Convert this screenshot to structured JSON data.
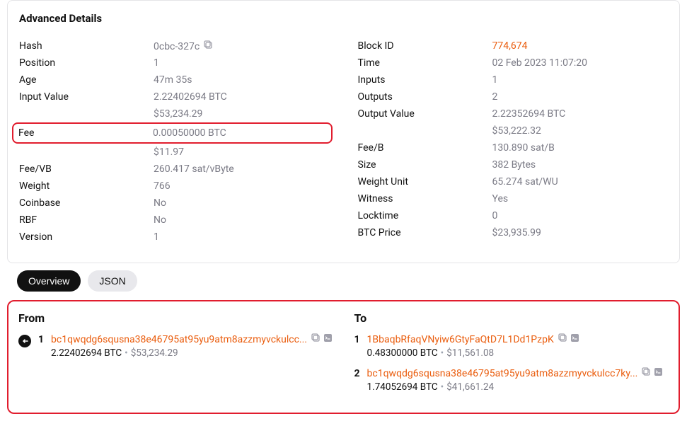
{
  "title": "Advanced Details",
  "left": [
    {
      "label": "Hash",
      "value": "0cbc-327c",
      "copy": true
    },
    {
      "label": "Position",
      "value": "1"
    },
    {
      "label": "Age",
      "value": "47m 35s"
    },
    {
      "label": "Input Value",
      "value": "2.22402694 BTC",
      "sub": "$53,234.29"
    },
    {
      "label": "Fee",
      "value": "0.00050000 BTC",
      "sub": "$11.97",
      "highlight": true
    },
    {
      "label": "Fee/VB",
      "value": "260.417 sat/vByte"
    },
    {
      "label": "Weight",
      "value": "766"
    },
    {
      "label": "Coinbase",
      "value": "No"
    },
    {
      "label": "RBF",
      "value": "No"
    },
    {
      "label": "Version",
      "value": "1"
    }
  ],
  "right": [
    {
      "label": "Block ID",
      "value": "774,674",
      "link": true
    },
    {
      "label": "Time",
      "value": "02 Feb 2023 11:07:20"
    },
    {
      "label": "Inputs",
      "value": "1"
    },
    {
      "label": "Outputs",
      "value": "2"
    },
    {
      "label": "Output Value",
      "value": "2.22352694 BTC",
      "sub": "$53,222.32"
    },
    {
      "label": "Fee/B",
      "value": "130.890 sat/B"
    },
    {
      "label": "Size",
      "value": "382 Bytes"
    },
    {
      "label": "Weight Unit",
      "value": "65.274 sat/WU"
    },
    {
      "label": "Witness",
      "value": "Yes"
    },
    {
      "label": "Locktime",
      "value": "0"
    },
    {
      "label": "BTC Price",
      "value": "$23,935.99"
    }
  ],
  "tabs": {
    "overview": "Overview",
    "json": "JSON"
  },
  "from_label": "From",
  "to_label": "To",
  "inputs": [
    {
      "idx": "1",
      "addr": "bc1qwqdg6squsna38e46795at95yu9atm8azzmyvckulcc...",
      "btc": "2.22402694 BTC",
      "usd": "$53,234.29",
      "arrow": true
    }
  ],
  "outputs": [
    {
      "idx": "1",
      "addr": "1BbaqbRfaqVNyiw6GtyFaQtD7L1Dd1PzpK",
      "btc": "0.48300000 BTC",
      "usd": "$11,561.08"
    },
    {
      "idx": "2",
      "addr": "bc1qwqdg6squsna38e46795at95yu9atm8azzmyvckulcc7ky...",
      "btc": "1.74052694 BTC",
      "usd": "$41,661.24"
    }
  ]
}
